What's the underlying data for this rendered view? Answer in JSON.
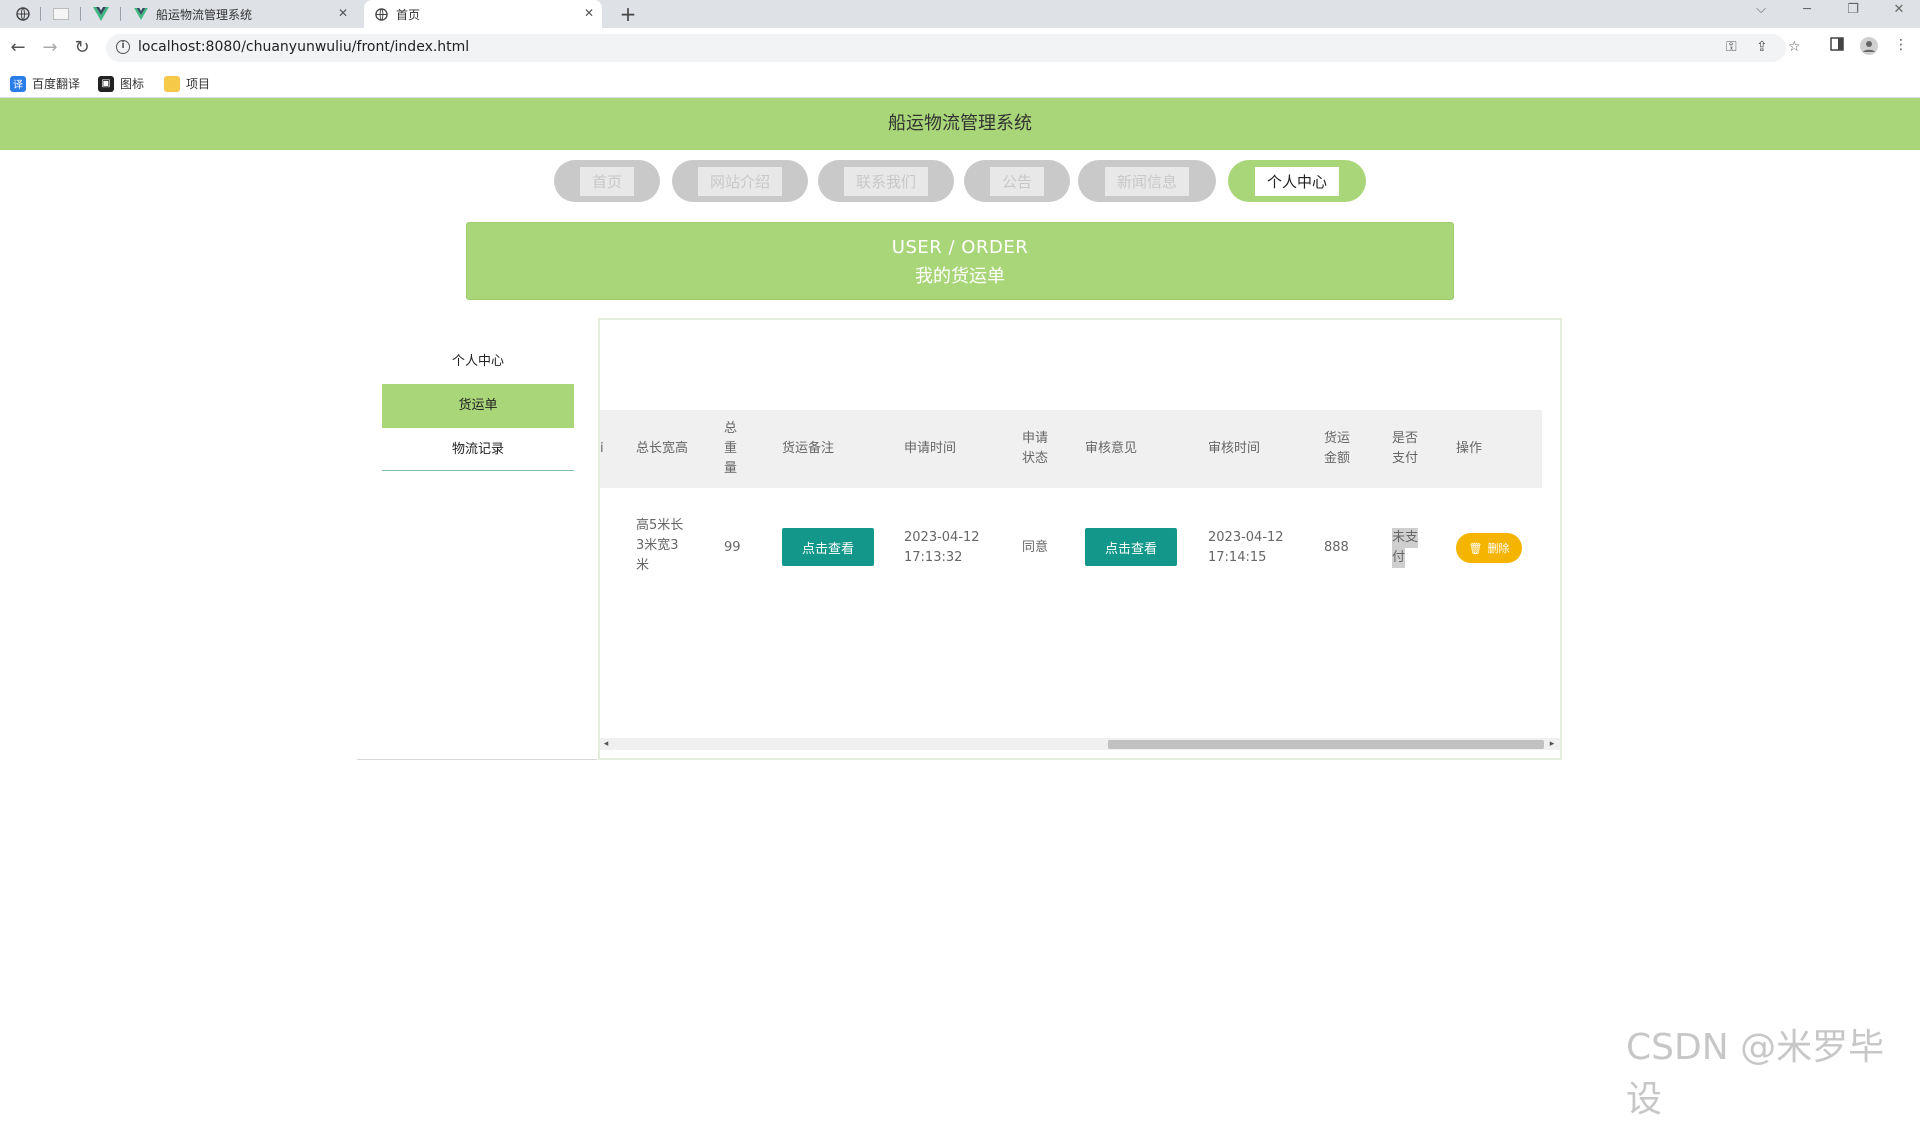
{
  "browser": {
    "tabs": [
      {
        "title": "船运物流管理系统",
        "active": false
      },
      {
        "title": "首页",
        "active": true
      }
    ],
    "url": "localhost:8080/chuanyunwuliu/front/index.html",
    "bookmarks": [
      {
        "label": "百度翻译"
      },
      {
        "label": "图标"
      },
      {
        "label": "项目"
      }
    ]
  },
  "site": {
    "title": "船运物流管理系统",
    "nav": [
      "首页",
      "网站介绍",
      "联系我们",
      "公告",
      "新闻信息",
      "个人中心"
    ],
    "active_nav_index": 5,
    "banner": {
      "en": "USER / ORDER",
      "cn": "我的货运单"
    }
  },
  "sidebar": {
    "items": [
      "个人中心",
      "货运单",
      "物流记录"
    ],
    "active_index": 1
  },
  "table": {
    "headers": {
      "truncated": "i",
      "size": "总长宽高",
      "weight_l1": "总",
      "weight_l2": "重",
      "weight_l3": "量",
      "remark": "货运备注",
      "apply_time": "申请时间",
      "status_l1": "申请",
      "status_l2": "状态",
      "review": "审核意见",
      "review_time": "审核时间",
      "amount_l1": "货运",
      "amount_l2": "金额",
      "paid_l1": "是否",
      "paid_l2": "支付",
      "ops": "操作"
    },
    "rows": [
      {
        "size_l1": "高5米长",
        "size_l2": "3米宽3",
        "size_l3": "米",
        "weight": "99",
        "remark_button": "点击查看",
        "apply_date": "2023-04-12",
        "apply_clock": "17:13:32",
        "status": "同意",
        "review_button": "点击查看",
        "review_date": "2023-04-12",
        "review_clock": "17:14:15",
        "amount": "888",
        "paid_l1": "未支",
        "paid_l2": "付",
        "delete_button": "删除"
      }
    ]
  },
  "watermark": "CSDN @米罗毕设",
  "colors": {
    "primary_green": "#a9d679",
    "teal_button": "#13978a",
    "delete_button": "#f5b400"
  }
}
